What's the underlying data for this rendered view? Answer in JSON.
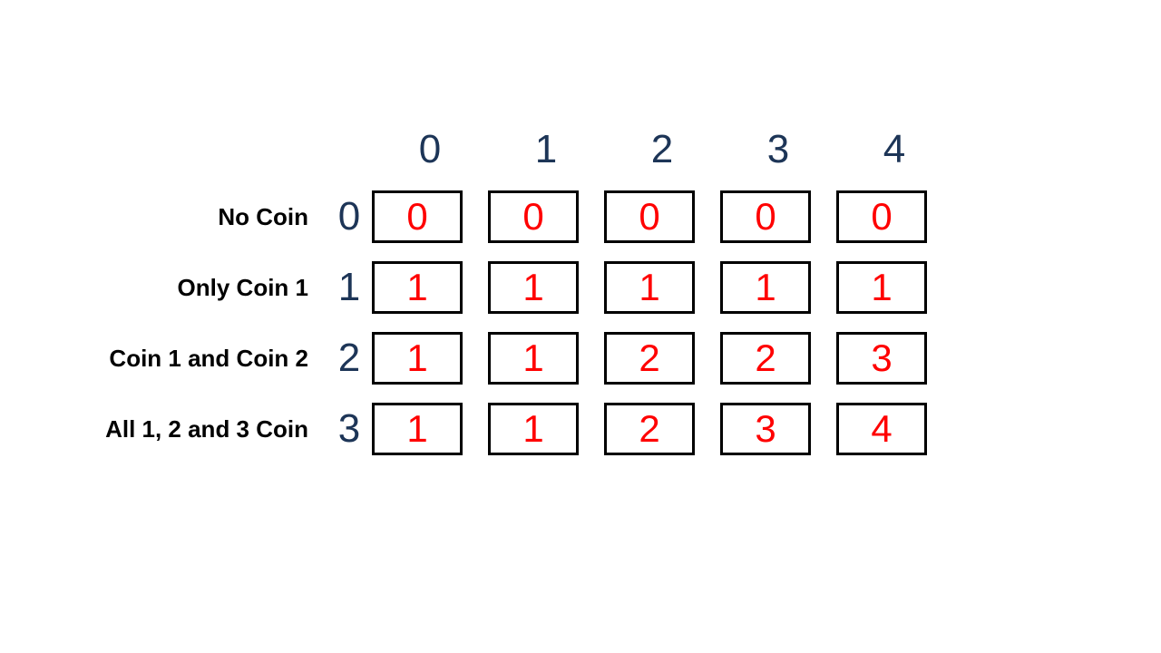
{
  "chart_data": {
    "type": "table",
    "title": "",
    "column_headers": [
      "0",
      "1",
      "2",
      "3",
      "4"
    ],
    "row_indices": [
      "0",
      "1",
      "2",
      "3"
    ],
    "row_labels": [
      "No Coin",
      "Only Coin 1",
      "Coin 1 and Coin 2",
      "All 1, 2 and 3 Coin"
    ],
    "cells": [
      [
        "0",
        "0",
        "0",
        "0",
        "0"
      ],
      [
        "1",
        "1",
        "1",
        "1",
        "1"
      ],
      [
        "1",
        "1",
        "2",
        "2",
        "3"
      ],
      [
        "1",
        "1",
        "2",
        "3",
        "4"
      ]
    ]
  }
}
